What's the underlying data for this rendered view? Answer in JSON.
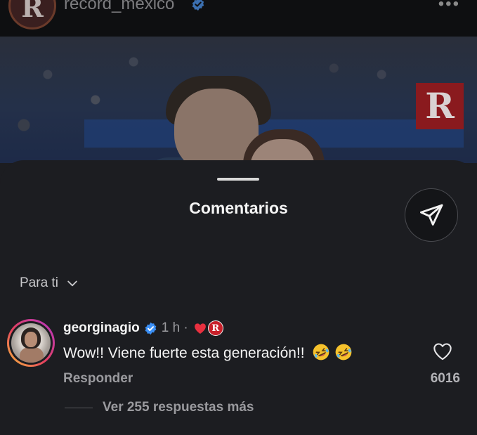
{
  "post": {
    "username": "record_mexico",
    "avatar_letter": "R",
    "more_label": "•••",
    "watermark_letter": "R"
  },
  "sheet": {
    "title": "Comentarios",
    "sort_label": "Para ti"
  },
  "comment": {
    "username": "georginagio",
    "time": "1 h ·",
    "text": "Wow!! Viene fuerte esta generación!!",
    "emojis": [
      "rolling-on-floor-laughing",
      "rolling-on-floor-laughing"
    ],
    "liked_by_creator_letter": "R",
    "reply_label": "Responder",
    "like_count": "6016",
    "replies_label": "Ver 255 respuestas más"
  },
  "colors": {
    "sheet_bg": "#1c1d21",
    "verified": "#3b8ff5",
    "creator_heart": "#e8303f",
    "record_red": "#c8202a"
  }
}
